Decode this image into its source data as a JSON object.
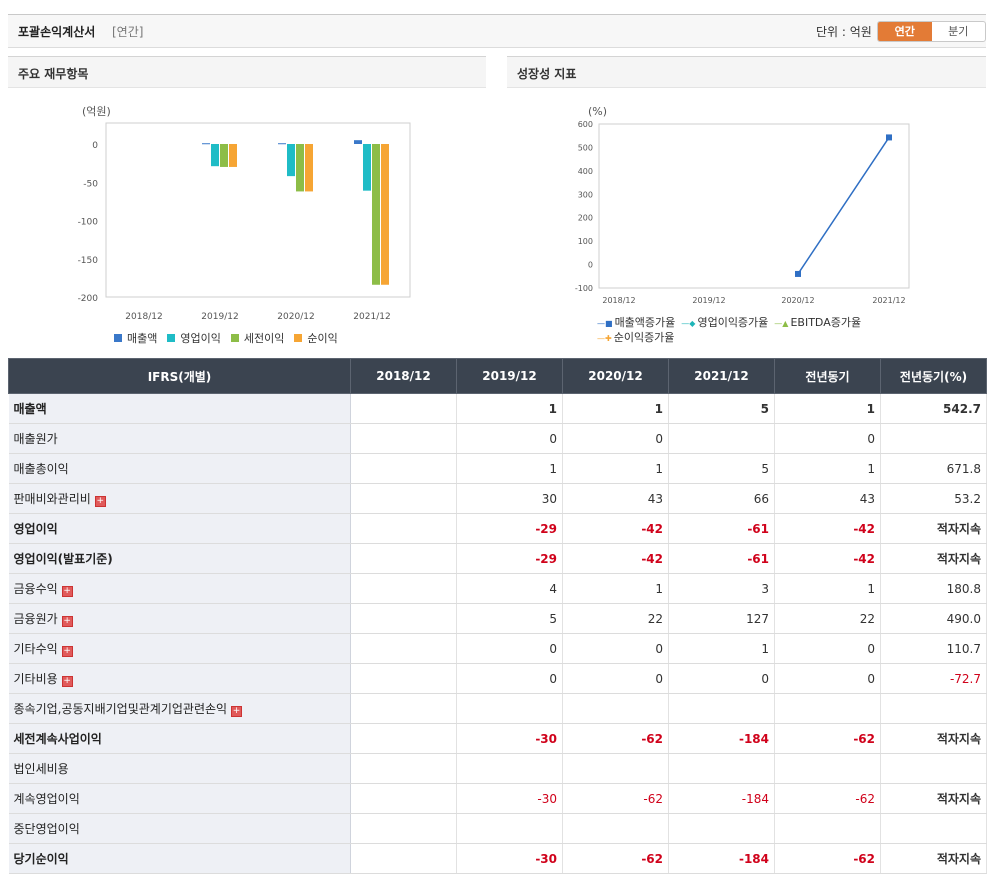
{
  "header": {
    "title": "포괄손익계산서",
    "subtitle": "[연간]",
    "unit_label": "단위 : 억원",
    "toggle": {
      "annual": "연간",
      "quarter": "분기",
      "selected": "연간"
    }
  },
  "colors": {
    "accent": "#e37b36",
    "table_header": "#3b4450",
    "negative": "#d0021b"
  },
  "panels": {
    "left_title": "주요 재무항목",
    "right_title": "성장성 지표"
  },
  "chart_data": [
    {
      "type": "bar",
      "title": "",
      "ylabel": "(억원)",
      "ylim": [
        -200,
        0
      ],
      "yticks": [
        0,
        -50,
        -100,
        -150,
        -200
      ],
      "categories": [
        "2018/12",
        "2019/12",
        "2020/12",
        "2021/12"
      ],
      "series": [
        {
          "name": "매출액",
          "color": "#3a78c9",
          "values": [
            null,
            1,
            1,
            5
          ]
        },
        {
          "name": "영업이익",
          "color": "#1fbcc6",
          "values": [
            null,
            -29,
            -42,
            -61
          ]
        },
        {
          "name": "세전이익",
          "color": "#8dbd47",
          "values": [
            null,
            -30,
            -62,
            -184
          ]
        },
        {
          "name": "순이익",
          "color": "#f6a534",
          "values": [
            null,
            -30,
            -62,
            -184
          ]
        }
      ],
      "legend": "bottom",
      "grid": false
    },
    {
      "type": "line",
      "title": "",
      "ylabel": "(%)",
      "ylim": [
        -100,
        600
      ],
      "yticks": [
        600,
        500,
        400,
        300,
        200,
        100,
        0,
        -100
      ],
      "categories": [
        "2018/12",
        "2019/12",
        "2020/12",
        "2021/12"
      ],
      "series": [
        {
          "name": "매출액증가율",
          "color": "#2f6fc4",
          "marker": "square",
          "values": [
            null,
            null,
            -40,
            542.7
          ]
        },
        {
          "name": "영업이익증가율",
          "color": "#1fb5b8",
          "marker": "diamond",
          "values": [
            null,
            null,
            null,
            null
          ]
        },
        {
          "name": "EBITDA증가율",
          "color": "#8dbd47",
          "marker": "triangle",
          "values": [
            null,
            null,
            null,
            null
          ]
        },
        {
          "name": "순이익증가율",
          "color": "#f6a534",
          "marker": "cross",
          "values": [
            null,
            null,
            null,
            null
          ]
        }
      ],
      "legend": "bottom",
      "grid": false
    }
  ],
  "table": {
    "headers": [
      "IFRS(개별)",
      "2018/12",
      "2019/12",
      "2020/12",
      "2021/12",
      "전년동기",
      "전년동기(%)"
    ],
    "rows": [
      {
        "label": "매출액",
        "expand": false,
        "bold": true,
        "cells": [
          "",
          "1",
          "1",
          "5",
          "1",
          "542.7"
        ]
      },
      {
        "label": "매출원가",
        "expand": false,
        "bold": false,
        "cells": [
          "",
          "0",
          "0",
          "",
          "0",
          ""
        ]
      },
      {
        "label": "매출총이익",
        "expand": false,
        "bold": false,
        "cells": [
          "",
          "1",
          "1",
          "5",
          "1",
          "671.8"
        ]
      },
      {
        "label": "판매비와관리비",
        "expand": true,
        "bold": false,
        "cells": [
          "",
          "30",
          "43",
          "66",
          "43",
          "53.2"
        ]
      },
      {
        "label": "영업이익",
        "expand": false,
        "bold": true,
        "cells": [
          "",
          "-29",
          "-42",
          "-61",
          "-42",
          "적자지속"
        ]
      },
      {
        "label": "영업이익(발표기준)",
        "expand": false,
        "bold": true,
        "cells": [
          "",
          "-29",
          "-42",
          "-61",
          "-42",
          "적자지속"
        ]
      },
      {
        "label": "금융수익",
        "expand": true,
        "bold": false,
        "cells": [
          "",
          "4",
          "1",
          "3",
          "1",
          "180.8"
        ]
      },
      {
        "label": "금융원가",
        "expand": true,
        "bold": false,
        "cells": [
          "",
          "5",
          "22",
          "127",
          "22",
          "490.0"
        ]
      },
      {
        "label": "기타수익",
        "expand": true,
        "bold": false,
        "cells": [
          "",
          "0",
          "0",
          "1",
          "0",
          "110.7"
        ]
      },
      {
        "label": "기타비용",
        "expand": true,
        "bold": false,
        "cells": [
          "",
          "0",
          "0",
          "0",
          "0",
          "-72.7"
        ]
      },
      {
        "label": "종속기업,공동지배기업및관계기업관련손익",
        "expand": true,
        "bold": false,
        "cells": [
          "",
          "",
          "",
          "",
          "",
          ""
        ]
      },
      {
        "label": "세전계속사업이익",
        "expand": false,
        "bold": true,
        "cells": [
          "",
          "-30",
          "-62",
          "-184",
          "-62",
          "적자지속"
        ]
      },
      {
        "label": "법인세비용",
        "expand": false,
        "bold": false,
        "cells": [
          "",
          "",
          "",
          "",
          "",
          ""
        ]
      },
      {
        "label": "계속영업이익",
        "expand": false,
        "bold": false,
        "cells": [
          "",
          "-30",
          "-62",
          "-184",
          "-62",
          "적자지속"
        ]
      },
      {
        "label": "중단영업이익",
        "expand": false,
        "bold": false,
        "cells": [
          "",
          "",
          "",
          "",
          "",
          ""
        ]
      },
      {
        "label": "당기순이익",
        "expand": false,
        "bold": true,
        "cells": [
          "",
          "-30",
          "-62",
          "-184",
          "-62",
          "적자지속"
        ]
      }
    ]
  }
}
